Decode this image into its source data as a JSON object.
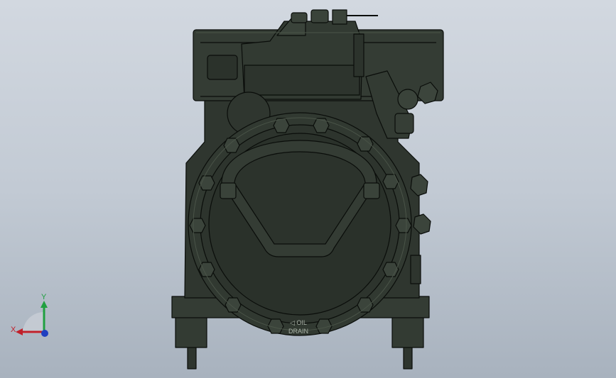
{
  "model": {
    "engraving_line1": "◁ OIL",
    "engraving_line2": "DRAIN"
  },
  "triad": {
    "x_label": "X",
    "y_label": "Y",
    "x_color": "#c0202a",
    "y_color": "#20a040",
    "z_color": "#2040c0"
  },
  "colors": {
    "body": "#303830",
    "edge": "#0a0d0a",
    "highlight": "#4a5448"
  }
}
